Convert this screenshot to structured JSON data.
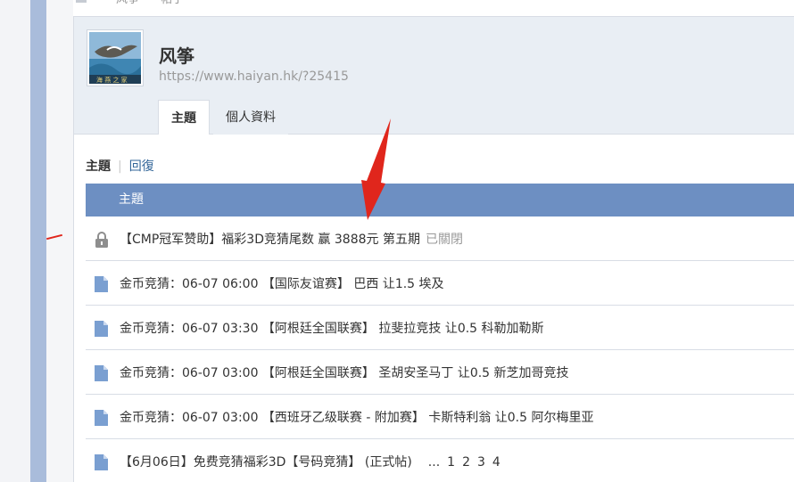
{
  "breadcrumb": {
    "sep": "›",
    "parent": "风筝",
    "current": "帖子"
  },
  "profile": {
    "name": "风筝",
    "url": "https://www.haiyan.hk/?25415"
  },
  "tabs": {
    "topics": "主題",
    "profile": "個人資料"
  },
  "subtabs": {
    "topics": "主題",
    "sep": "|",
    "replies": "回復"
  },
  "table": {
    "header": "主題"
  },
  "threads": [
    {
      "title": "【CMP冠军赞助】福彩3D竞猜尾数 赢 3888元 第五期",
      "status": "已關閉",
      "icon": "lock-icon"
    },
    {
      "title": "金币竞猜：06-07 06:00 【国际友谊赛】 巴西 让1.5 埃及",
      "icon": "document-icon"
    },
    {
      "title": "金币竞猜：06-07 03:30 【阿根廷全国联赛】 拉斐拉竞技 让0.5 科勒加勒斯",
      "icon": "document-icon"
    },
    {
      "title": "金币竞猜：06-07 03:00 【阿根廷全国联赛】 圣胡安圣马丁 让0.5 新芝加哥竞技",
      "icon": "document-icon"
    },
    {
      "title": "金币竞猜：06-07 03:00 【西班牙乙级联赛 - 附加赛】 卡斯特利翁 让0.5 阿尔梅里亚",
      "icon": "document-icon"
    },
    {
      "title": "【6月06日】免费竞猜福彩3D【号码竞猜】 (正式帖)",
      "icon": "document-icon",
      "pages": [
        "...",
        "1",
        "2",
        "3",
        "4"
      ]
    }
  ],
  "colors": {
    "header_bg": "#6d8fc2",
    "link": "#336699",
    "icon_blue": "#7a9fd1",
    "lock_gray": "#8e8e8e",
    "annotation_red": "#e0261c"
  }
}
